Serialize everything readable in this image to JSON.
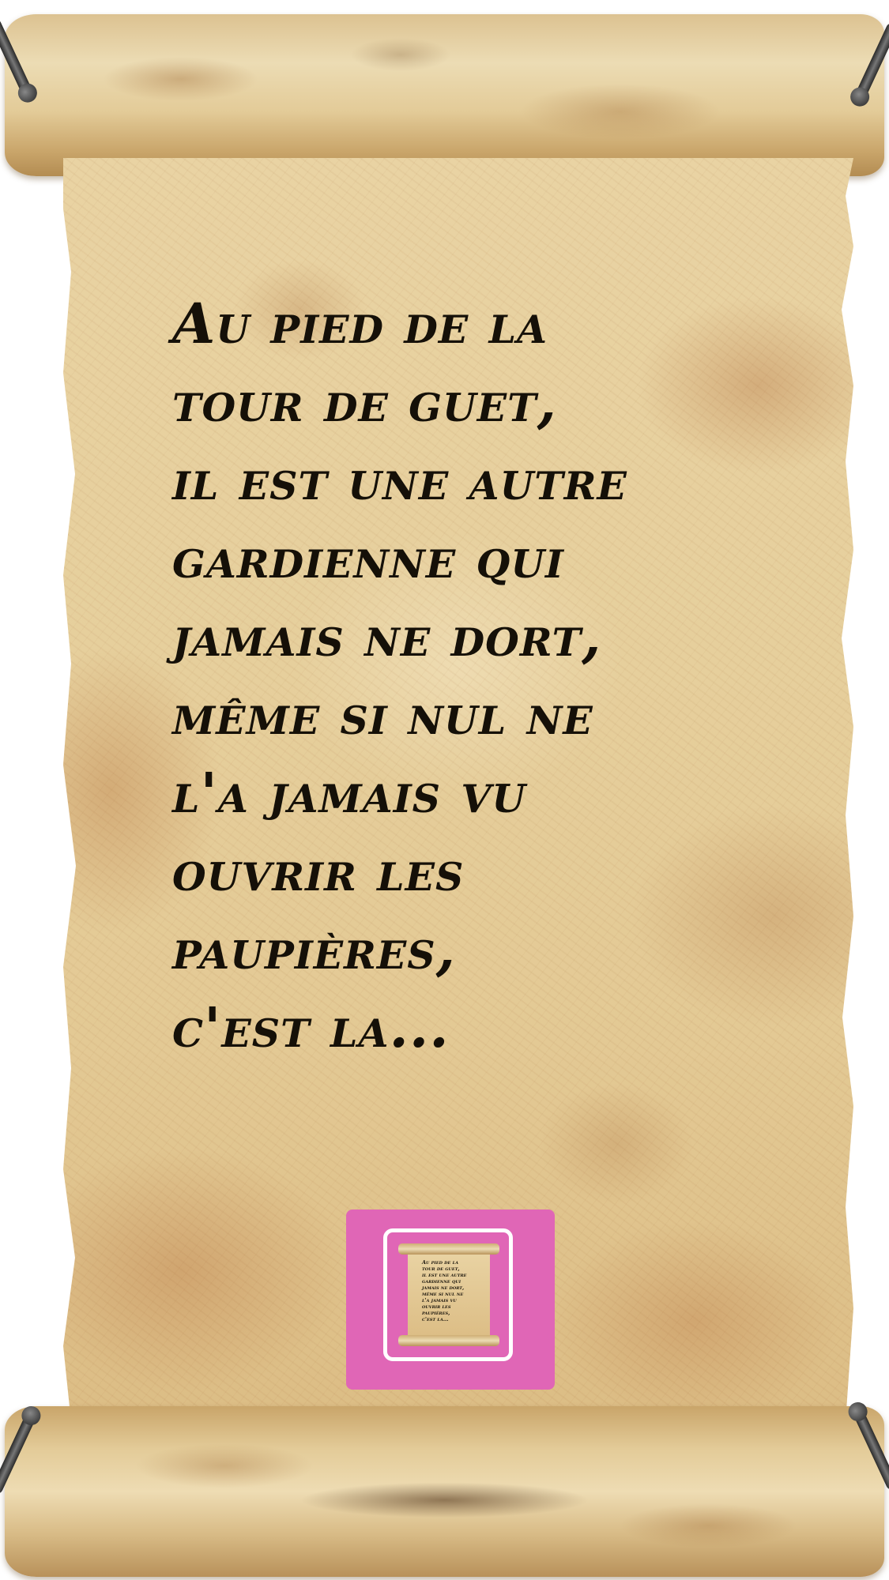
{
  "poem": {
    "lines": [
      "Au pied de la",
      "tour de guet,",
      "il est une autre",
      "gardienne qui",
      "jamais ne dort,",
      "même si nul ne",
      "l'a jamais vu",
      "ouvrir les",
      "paupières,",
      "c'est la..."
    ]
  },
  "thumbnail": {
    "background_color": "#e066b6",
    "frame_color": "#ffffff"
  },
  "colors": {
    "parchment": "#e6cf9c",
    "text": "#151008"
  }
}
